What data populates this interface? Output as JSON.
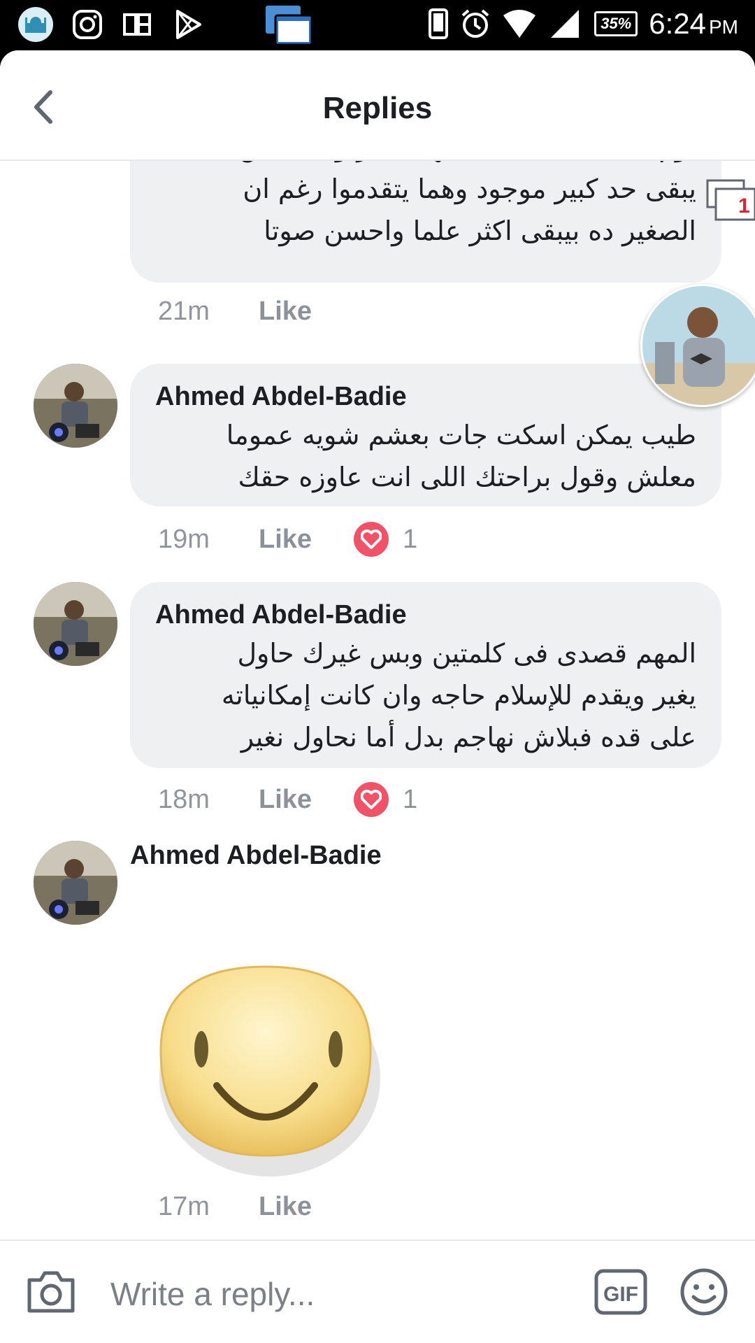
{
  "status_bar": {
    "time": "6:24",
    "ampm": "PM",
    "battery": "35%"
  },
  "header": {
    "title": "Replies"
  },
  "floating": {
    "notification_count": "1"
  },
  "comments": [
    {
      "author": "",
      "lines": [
        "تؤم الصلاة بحجة ان سنها صغير وميصحش",
        "يبقى حد كبير موجود وهما يتقدموا رغم ان",
        "الصغير ده بيبقى اكثر علما واحسن صوتا"
      ],
      "time": "21m",
      "like": "Like"
    },
    {
      "author": "Ahmed Abdel-Badie",
      "lines": [
        "طيب يمكن اسكت جات بعشم شويه عموما",
        "معلش وقول براحتك اللى انت عاوزه حقك"
      ],
      "time": "19m",
      "like": "Like",
      "reactions": "1"
    },
    {
      "author": "Ahmed Abdel-Badie",
      "lines": [
        "المهم قصدى فى كلمتين وبس غيرك حاول",
        "يغير ويقدم للإسلام حاجه وان كانت إمكانياته",
        "على قده فبلاش نهاجم بدل أما نحاول نغير"
      ],
      "time": "18m",
      "like": "Like",
      "reactions": "1"
    },
    {
      "author": "Ahmed Abdel-Badie",
      "sticker": "smiley-sticker",
      "time": "17m",
      "like": "Like"
    }
  ],
  "composer": {
    "placeholder": "Write a reply...",
    "gif_label": "GIF"
  },
  "icons": {
    "back": "chevron-left-icon",
    "camera": "camera-icon",
    "emoji": "smiley-icon",
    "heart": "heart-icon"
  },
  "colors": {
    "bubble": "#eff0f2",
    "heart": "#f25268",
    "meta_text": "#90949c"
  }
}
